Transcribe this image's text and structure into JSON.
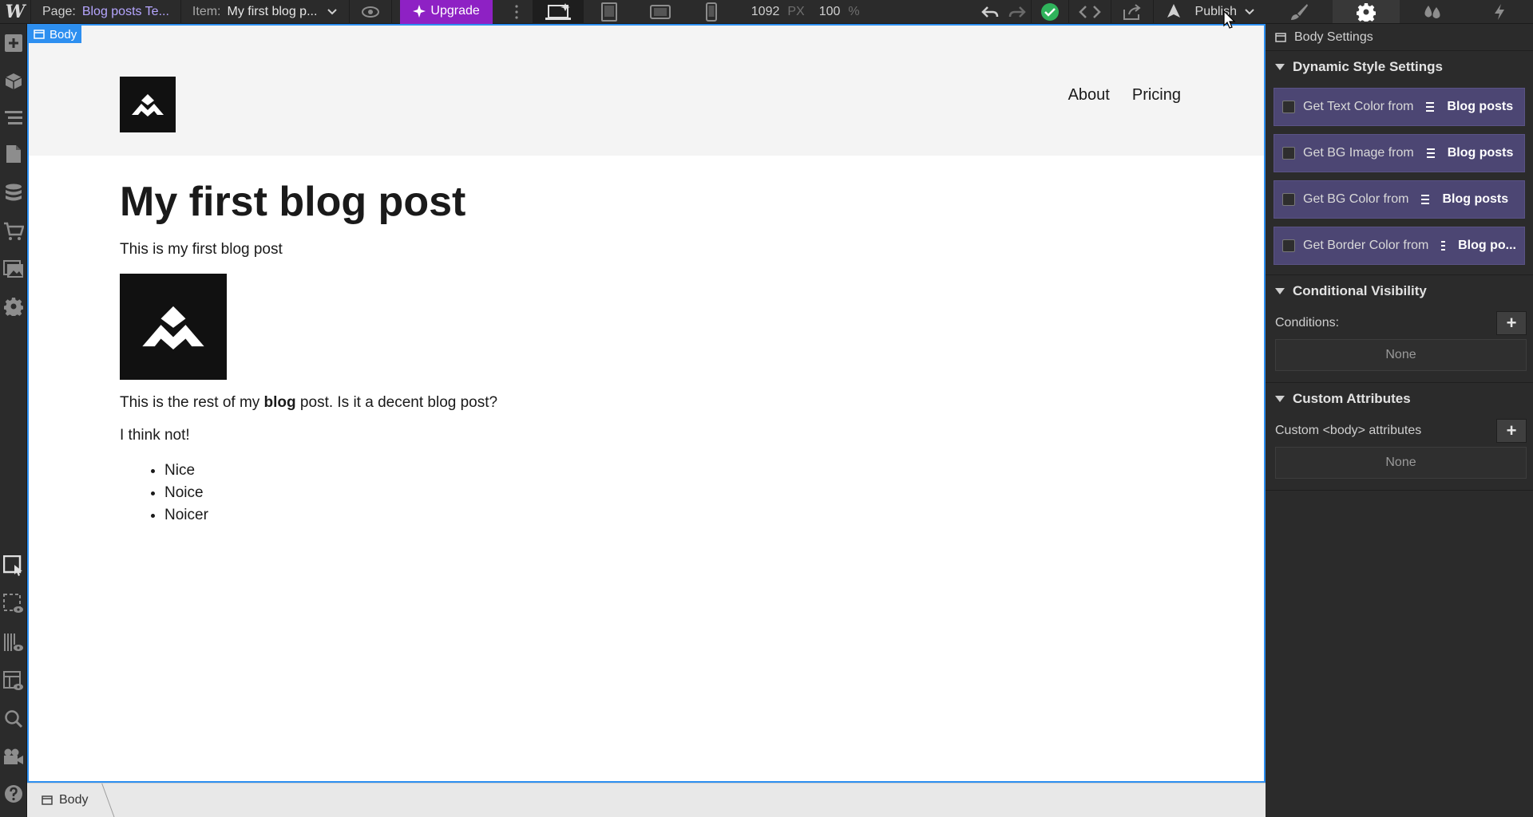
{
  "topbar": {
    "logo": "W",
    "page_label": "Page:",
    "page_value": "Blog posts Te...",
    "item_label": "Item:",
    "item_value": "My first blog p...",
    "upgrade_label": "Upgrade",
    "width_value": "1092",
    "width_unit": "PX",
    "zoom_value": "100",
    "zoom_unit": "%",
    "publish_label": "Publish"
  },
  "canvas": {
    "selection_tag": "Body",
    "nav": [
      "About",
      "Pricing"
    ],
    "title": "My first blog post",
    "subtitle": "This is my first blog post",
    "body_before_bold": "This is the rest of my ",
    "body_bold": "blog",
    "body_after_bold": " post. Is it a decent blog post?",
    "second_paragraph": "I think not!",
    "list": [
      "Nice",
      "Noice",
      "Noicer"
    ]
  },
  "statusbar": {
    "breadcrumb": "Body"
  },
  "panel": {
    "header": "Body Settings",
    "dynamic": {
      "title": "Dynamic Style Settings",
      "rows": [
        {
          "label": "Get Text Color from",
          "source": "Blog posts"
        },
        {
          "label": "Get BG Image from",
          "source": "Blog posts"
        },
        {
          "label": "Get BG Color from",
          "source": "Blog posts"
        },
        {
          "label": "Get Border Color from",
          "source": "Blog po..."
        }
      ]
    },
    "visibility": {
      "title": "Conditional Visibility",
      "label": "Conditions:",
      "value": "None"
    },
    "attributes": {
      "title": "Custom Attributes",
      "label": "Custom <body> attributes",
      "value": "None"
    }
  },
  "colors": {
    "accent": "#2d8ff0",
    "upgrade": "#8e21c4",
    "dynamic_row": "#4c4673",
    "success": "#2fb35b"
  }
}
